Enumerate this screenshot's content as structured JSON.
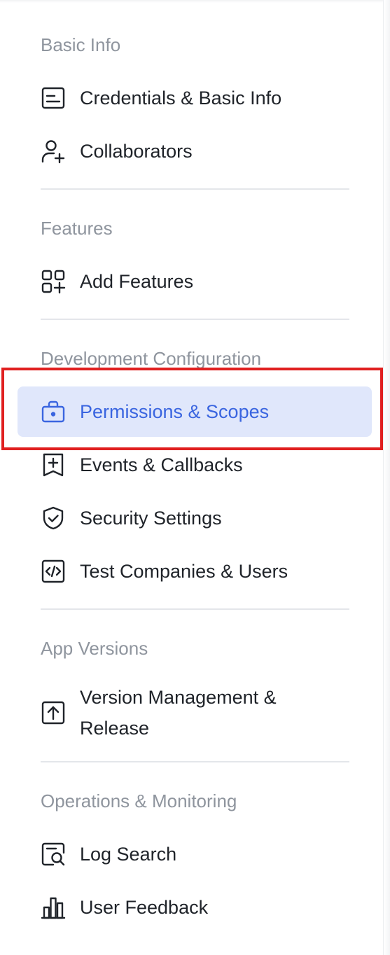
{
  "sections": [
    {
      "title": "Basic Info",
      "items": [
        {
          "label": "Credentials & Basic Info",
          "icon": "id-card-icon"
        },
        {
          "label": "Collaborators",
          "icon": "user-add-icon"
        }
      ]
    },
    {
      "title": "Features",
      "items": [
        {
          "label": "Add Features",
          "icon": "add-app-icon"
        }
      ]
    },
    {
      "title": "Development Configuration",
      "items": [
        {
          "label": "Permissions & Scopes",
          "icon": "briefcase-icon",
          "active": true
        },
        {
          "label": "Events & Callbacks",
          "icon": "event-add-icon"
        },
        {
          "label": "Security Settings",
          "icon": "shield-check-icon"
        },
        {
          "label": "Test Companies & Users",
          "icon": "code-icon"
        }
      ]
    },
    {
      "title": "App Versions",
      "items": [
        {
          "label": "Version Management & Release",
          "icon": "upload-icon"
        }
      ]
    },
    {
      "title": "Operations & Monitoring",
      "items": [
        {
          "label": "Log Search",
          "icon": "log-search-icon"
        },
        {
          "label": "User Feedback",
          "icon": "bar-chart-icon"
        }
      ]
    }
  ],
  "colors": {
    "active_bg": "#e0e7fb",
    "active_text": "#3a65e0",
    "highlight": "#e02020",
    "section_title": "#8f959e"
  }
}
